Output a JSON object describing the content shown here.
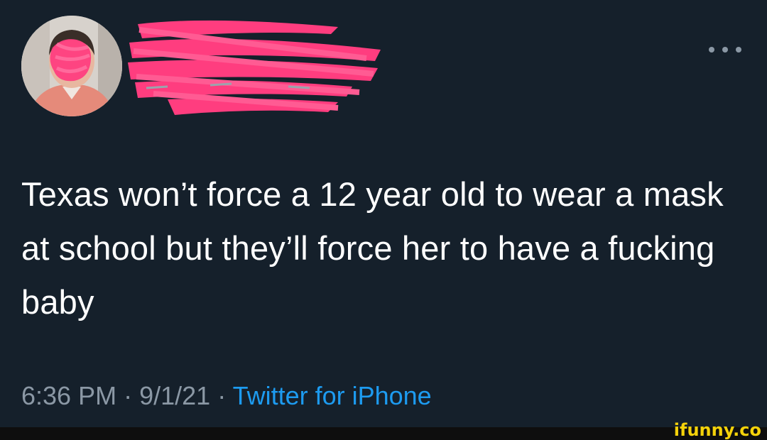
{
  "tweet": {
    "text": "Texas won’t force a 12 year old to wear a mask at school but they’ll force her to have a fucking baby",
    "time": "6:36 PM",
    "date": "9/1/21",
    "separator": "·",
    "source": "Twitter for iPhone"
  },
  "icons": {
    "more": "more-options-icon"
  },
  "watermark": "ifunny.co",
  "colors": {
    "background": "#15202b",
    "text": "#ffffff",
    "secondary_text": "#8b98a5",
    "link": "#1d9bf0",
    "redaction_marker": "#ff3d7f",
    "watermark": "#f5d20a"
  }
}
